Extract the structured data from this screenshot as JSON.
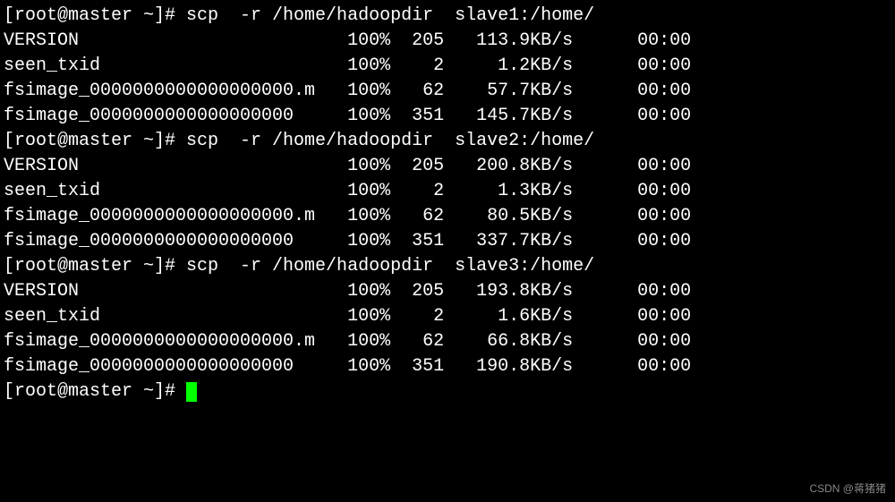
{
  "prompt": {
    "user": "root",
    "host": "master",
    "dir": "~",
    "symbol": "#"
  },
  "command": {
    "cmd": "scp",
    "args": "-r /home/hadoopdir"
  },
  "transfers": [
    {
      "dest": "slave1:/home/",
      "files": [
        {
          "name": "VERSION",
          "pct": "100%",
          "size": "205",
          "rate": "113.9KB/s",
          "time": "00:00"
        },
        {
          "name": "seen_txid",
          "pct": "100%",
          "size": "2",
          "rate": "1.2KB/s",
          "time": "00:00"
        },
        {
          "name": "fsimage_0000000000000000000.m",
          "pct": "100%",
          "size": "62",
          "rate": "57.7KB/s",
          "time": "00:00"
        },
        {
          "name": "fsimage_0000000000000000000",
          "pct": "100%",
          "size": "351",
          "rate": "145.7KB/s",
          "time": "00:00"
        }
      ]
    },
    {
      "dest": "slave2:/home/",
      "files": [
        {
          "name": "VERSION",
          "pct": "100%",
          "size": "205",
          "rate": "200.8KB/s",
          "time": "00:00"
        },
        {
          "name": "seen_txid",
          "pct": "100%",
          "size": "2",
          "rate": "1.3KB/s",
          "time": "00:00"
        },
        {
          "name": "fsimage_0000000000000000000.m",
          "pct": "100%",
          "size": "62",
          "rate": "80.5KB/s",
          "time": "00:00"
        },
        {
          "name": "fsimage_0000000000000000000",
          "pct": "100%",
          "size": "351",
          "rate": "337.7KB/s",
          "time": "00:00"
        }
      ]
    },
    {
      "dest": "slave3:/home/",
      "files": [
        {
          "name": "VERSION",
          "pct": "100%",
          "size": "205",
          "rate": "193.8KB/s",
          "time": "00:00"
        },
        {
          "name": "seen_txid",
          "pct": "100%",
          "size": "2",
          "rate": "1.6KB/s",
          "time": "00:00"
        },
        {
          "name": "fsimage_0000000000000000000.m",
          "pct": "100%",
          "size": "62",
          "rate": "66.8KB/s",
          "time": "00:00"
        },
        {
          "name": "fsimage_0000000000000000000",
          "pct": "100%",
          "size": "351",
          "rate": "190.8KB/s",
          "time": "00:00"
        }
      ]
    }
  ],
  "watermark": "CSDN @蒋猪猪"
}
